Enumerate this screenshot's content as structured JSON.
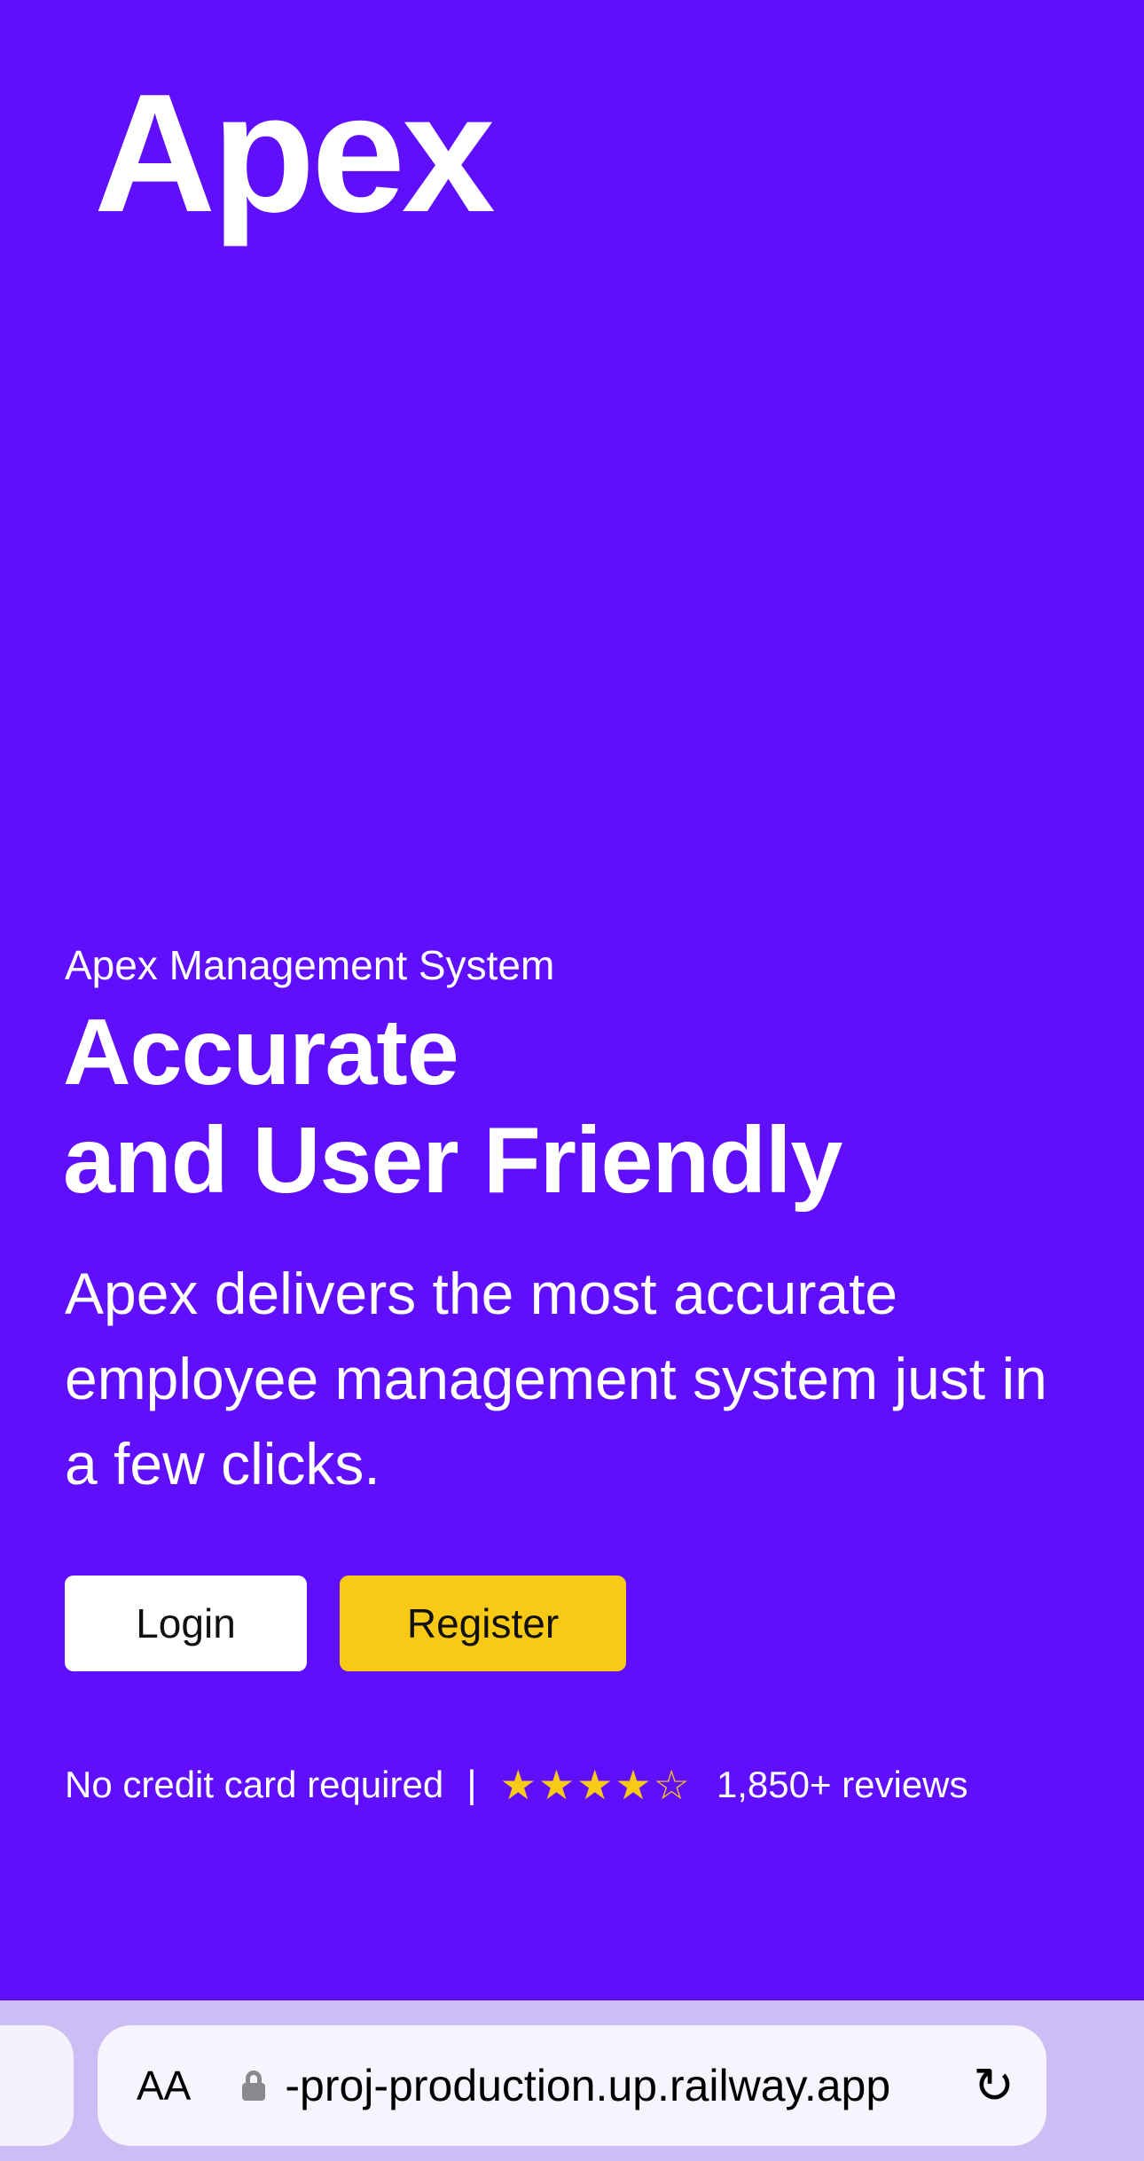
{
  "logo": "Apex",
  "hero": {
    "eyebrow": "Apex Management System",
    "headline_line1": "Accurate",
    "headline_line2": "and User Friendly",
    "description": "Apex delivers the most accurate employee management system just in a few clicks."
  },
  "buttons": {
    "login": "Login",
    "register": "Register"
  },
  "footer": {
    "no_card": "No credit card required",
    "separator": "|",
    "rating": 4,
    "rating_max": 5,
    "stars": "★★★★☆",
    "reviews": "1,850+ reviews"
  },
  "browser": {
    "text_size": "AA",
    "url": "-proj-production.up.railway.app",
    "lock_icon": "lock-icon",
    "reload_icon": "reload-icon"
  },
  "colors": {
    "background": "#5f0ffc",
    "register": "#f8c915",
    "toolbar": "#cdbdf5"
  }
}
